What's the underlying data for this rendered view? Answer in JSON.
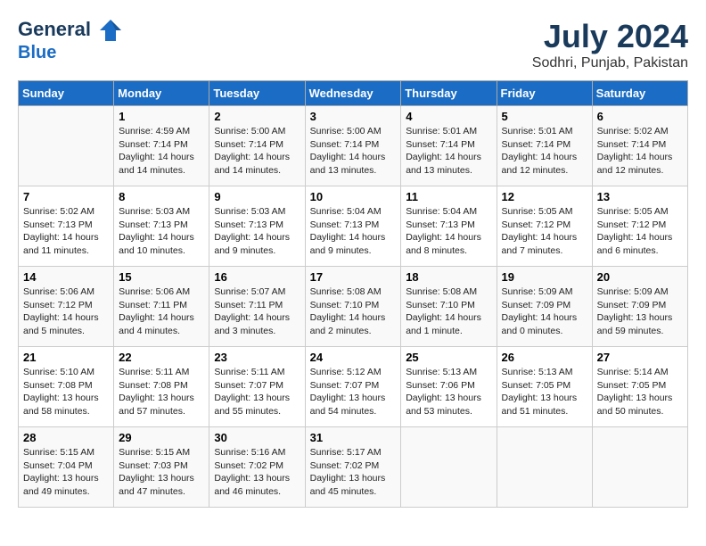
{
  "header": {
    "logo_line1": "General",
    "logo_line2": "Blue",
    "month_year": "July 2024",
    "location": "Sodhri, Punjab, Pakistan"
  },
  "weekdays": [
    "Sunday",
    "Monday",
    "Tuesday",
    "Wednesday",
    "Thursday",
    "Friday",
    "Saturday"
  ],
  "weeks": [
    [
      {
        "day": "",
        "info": ""
      },
      {
        "day": "1",
        "info": "Sunrise: 4:59 AM\nSunset: 7:14 PM\nDaylight: 14 hours\nand 14 minutes."
      },
      {
        "day": "2",
        "info": "Sunrise: 5:00 AM\nSunset: 7:14 PM\nDaylight: 14 hours\nand 14 minutes."
      },
      {
        "day": "3",
        "info": "Sunrise: 5:00 AM\nSunset: 7:14 PM\nDaylight: 14 hours\nand 13 minutes."
      },
      {
        "day": "4",
        "info": "Sunrise: 5:01 AM\nSunset: 7:14 PM\nDaylight: 14 hours\nand 13 minutes."
      },
      {
        "day": "5",
        "info": "Sunrise: 5:01 AM\nSunset: 7:14 PM\nDaylight: 14 hours\nand 12 minutes."
      },
      {
        "day": "6",
        "info": "Sunrise: 5:02 AM\nSunset: 7:14 PM\nDaylight: 14 hours\nand 12 minutes."
      }
    ],
    [
      {
        "day": "7",
        "info": "Sunrise: 5:02 AM\nSunset: 7:13 PM\nDaylight: 14 hours\nand 11 minutes."
      },
      {
        "day": "8",
        "info": "Sunrise: 5:03 AM\nSunset: 7:13 PM\nDaylight: 14 hours\nand 10 minutes."
      },
      {
        "day": "9",
        "info": "Sunrise: 5:03 AM\nSunset: 7:13 PM\nDaylight: 14 hours\nand 9 minutes."
      },
      {
        "day": "10",
        "info": "Sunrise: 5:04 AM\nSunset: 7:13 PM\nDaylight: 14 hours\nand 9 minutes."
      },
      {
        "day": "11",
        "info": "Sunrise: 5:04 AM\nSunset: 7:13 PM\nDaylight: 14 hours\nand 8 minutes."
      },
      {
        "day": "12",
        "info": "Sunrise: 5:05 AM\nSunset: 7:12 PM\nDaylight: 14 hours\nand 7 minutes."
      },
      {
        "day": "13",
        "info": "Sunrise: 5:05 AM\nSunset: 7:12 PM\nDaylight: 14 hours\nand 6 minutes."
      }
    ],
    [
      {
        "day": "14",
        "info": "Sunrise: 5:06 AM\nSunset: 7:12 PM\nDaylight: 14 hours\nand 5 minutes."
      },
      {
        "day": "15",
        "info": "Sunrise: 5:06 AM\nSunset: 7:11 PM\nDaylight: 14 hours\nand 4 minutes."
      },
      {
        "day": "16",
        "info": "Sunrise: 5:07 AM\nSunset: 7:11 PM\nDaylight: 14 hours\nand 3 minutes."
      },
      {
        "day": "17",
        "info": "Sunrise: 5:08 AM\nSunset: 7:10 PM\nDaylight: 14 hours\nand 2 minutes."
      },
      {
        "day": "18",
        "info": "Sunrise: 5:08 AM\nSunset: 7:10 PM\nDaylight: 14 hours\nand 1 minute."
      },
      {
        "day": "19",
        "info": "Sunrise: 5:09 AM\nSunset: 7:09 PM\nDaylight: 14 hours\nand 0 minutes."
      },
      {
        "day": "20",
        "info": "Sunrise: 5:09 AM\nSunset: 7:09 PM\nDaylight: 13 hours\nand 59 minutes."
      }
    ],
    [
      {
        "day": "21",
        "info": "Sunrise: 5:10 AM\nSunset: 7:08 PM\nDaylight: 13 hours\nand 58 minutes."
      },
      {
        "day": "22",
        "info": "Sunrise: 5:11 AM\nSunset: 7:08 PM\nDaylight: 13 hours\nand 57 minutes."
      },
      {
        "day": "23",
        "info": "Sunrise: 5:11 AM\nSunset: 7:07 PM\nDaylight: 13 hours\nand 55 minutes."
      },
      {
        "day": "24",
        "info": "Sunrise: 5:12 AM\nSunset: 7:07 PM\nDaylight: 13 hours\nand 54 minutes."
      },
      {
        "day": "25",
        "info": "Sunrise: 5:13 AM\nSunset: 7:06 PM\nDaylight: 13 hours\nand 53 minutes."
      },
      {
        "day": "26",
        "info": "Sunrise: 5:13 AM\nSunset: 7:05 PM\nDaylight: 13 hours\nand 51 minutes."
      },
      {
        "day": "27",
        "info": "Sunrise: 5:14 AM\nSunset: 7:05 PM\nDaylight: 13 hours\nand 50 minutes."
      }
    ],
    [
      {
        "day": "28",
        "info": "Sunrise: 5:15 AM\nSunset: 7:04 PM\nDaylight: 13 hours\nand 49 minutes."
      },
      {
        "day": "29",
        "info": "Sunrise: 5:15 AM\nSunset: 7:03 PM\nDaylight: 13 hours\nand 47 minutes."
      },
      {
        "day": "30",
        "info": "Sunrise: 5:16 AM\nSunset: 7:02 PM\nDaylight: 13 hours\nand 46 minutes."
      },
      {
        "day": "31",
        "info": "Sunrise: 5:17 AM\nSunset: 7:02 PM\nDaylight: 13 hours\nand 45 minutes."
      },
      {
        "day": "",
        "info": ""
      },
      {
        "day": "",
        "info": ""
      },
      {
        "day": "",
        "info": ""
      }
    ]
  ]
}
